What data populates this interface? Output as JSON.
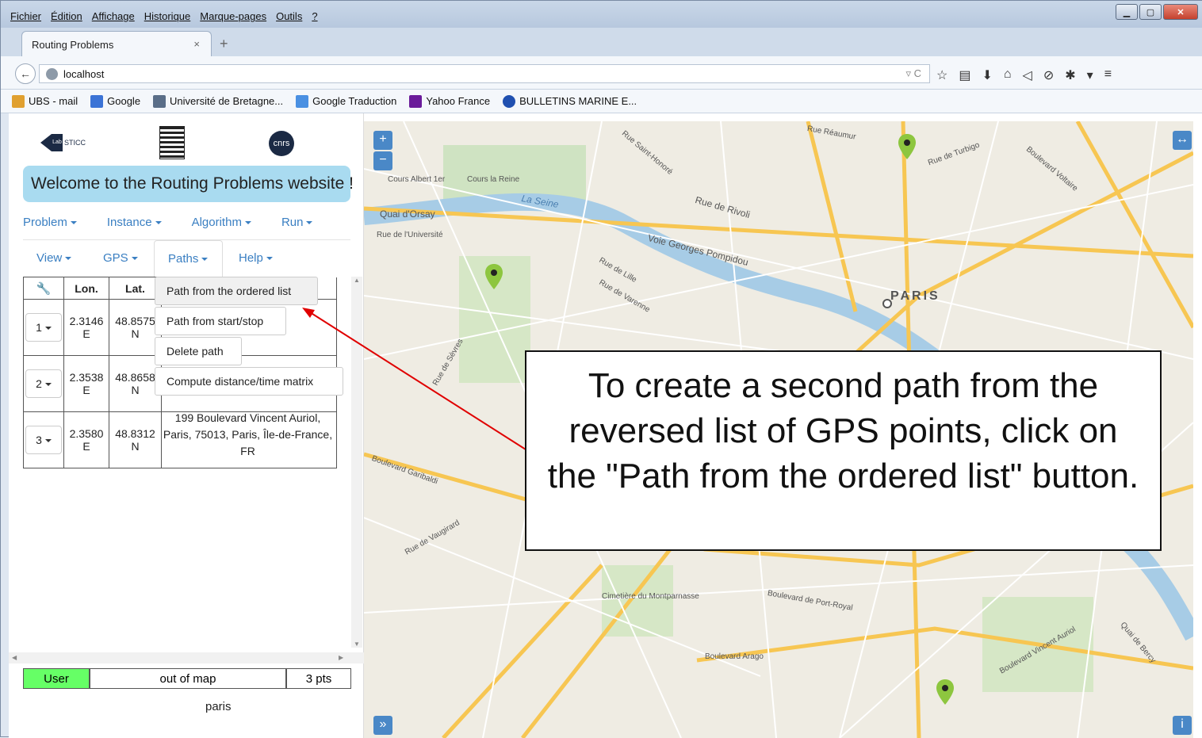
{
  "browser": {
    "menu": [
      "Fichier",
      "Édition",
      "Affichage",
      "Historique",
      "Marque-pages",
      "Outils",
      "?"
    ],
    "tab_title": "Routing Problems",
    "url": "localhost",
    "bookmarks": [
      "UBS - mail",
      "Google",
      "Université de Bretagne...",
      "Google Traduction",
      "Yahoo France",
      "BULLETINS MARINE E..."
    ]
  },
  "header": {
    "welcome": "Welcome to the Routing Problems website !",
    "logo_lab_text": "STICC",
    "logo_lab_badge": "Lab",
    "logo_cnrs_text": "cnrs"
  },
  "nav": {
    "row1": [
      "Problem",
      "Instance",
      "Algorithm",
      "Run"
    ],
    "row2": [
      "View",
      "GPS",
      "Paths",
      "Help"
    ]
  },
  "table": {
    "headers": [
      "Lon.",
      "Lat."
    ],
    "rows": [
      {
        "btn": "1",
        "lon": "2.3146",
        "lon_dir": "E",
        "lat": "48.8575",
        "lat_dir": "N"
      },
      {
        "btn": "2",
        "lon": "2.3538",
        "lon_dir": "E",
        "lat": "48.8658",
        "lat_dir": "N"
      },
      {
        "btn": "3",
        "lon": "2.3580",
        "lon_dir": "E",
        "lat": "48.8312",
        "lat_dir": "N"
      }
    ],
    "row3_address": "199 Boulevard Vincent Auriol, Paris, 75013, Paris, Île-de-France, FR"
  },
  "paths_menu": {
    "items": [
      "Path from the ordered list",
      "Path from start/stop",
      "Delete path",
      "Compute distance/time matrix"
    ],
    "highlighted": "Path from the ordered list"
  },
  "status": {
    "mode": "User",
    "mode_color": "#66ff66",
    "location": "out of map",
    "count": "3 pts",
    "city": "paris"
  },
  "map": {
    "zoom_in": "+",
    "zoom_out": "−",
    "city_label": "PARIS",
    "street_labels": [
      "Cours la Reine",
      "Cours Albert 1er",
      "Quai d'Orsay",
      "La Seine",
      "Rue de Rivoli",
      "Voie Georges Pompidou",
      "Rue Saint-Honoré",
      "Rue de Turbigo",
      "Boulevard Voltaire",
      "Rue de Lille",
      "Boulevard Garibaldi",
      "Rue de Vaugirard",
      "Cimetière du Montparnasse",
      "Boulevard de Port-Royal",
      "Boulevard Arago",
      "Boulevard Vincent Auriol",
      "Quai de Bercy",
      "Rue Réaumur",
      "Rue de l'Université",
      "Rue de Varenne",
      "Rue de Sèvres"
    ],
    "pin_color": "#8dc63f"
  },
  "annotation": {
    "text": "To create a second path from the reversed list of GPS points, click on the \"Path from the ordered list\" button.",
    "arrow_color": "#e00000"
  }
}
